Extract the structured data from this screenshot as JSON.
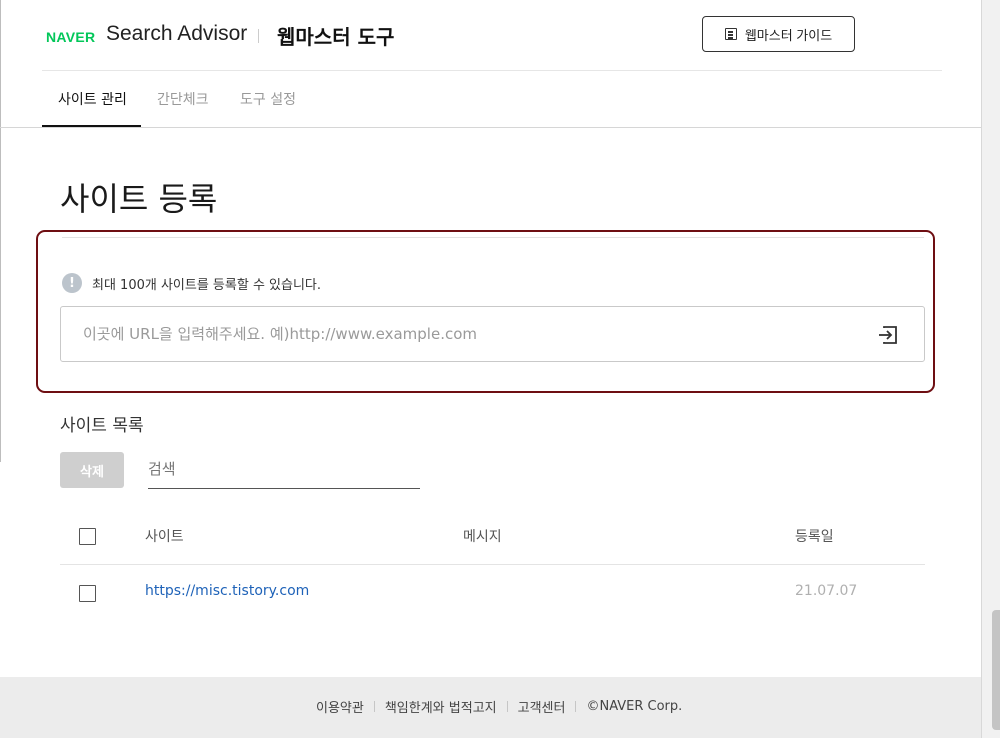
{
  "header": {
    "logo_naver": "NAVER",
    "logo_product": "Search Advisor",
    "title": "웹마스터 도구",
    "guide_button": "웹마스터 가이드"
  },
  "tabs": [
    {
      "label": "사이트 관리",
      "active": true
    },
    {
      "label": "간단체크",
      "active": false
    },
    {
      "label": "도구 설정",
      "active": false
    }
  ],
  "page_title": "사이트 등록",
  "registration": {
    "notice": "최대 100개 사이트를 등록할 수 있습니다.",
    "notice_icon": "exclamation-icon",
    "url_placeholder": "이곳에 URL을 입력해주세요. 예)http://www.example.com",
    "submit_icon": "enter-arrow-icon"
  },
  "site_list": {
    "title": "사이트 목록",
    "delete_button": "삭제",
    "search_placeholder": "검색",
    "columns": [
      "사이트",
      "메시지",
      "등록일"
    ],
    "rows": [
      {
        "site": "https://misc.tistory.com",
        "message": "",
        "date": "21.07.07"
      }
    ]
  },
  "footer": {
    "links": [
      "이용약관",
      "책임한계와 법적고지",
      "고객센터",
      "©NAVER Corp."
    ]
  },
  "colors": {
    "brand_green": "#03c75a",
    "highlight_border": "#6e0e12",
    "link_blue": "#1e62b8"
  }
}
